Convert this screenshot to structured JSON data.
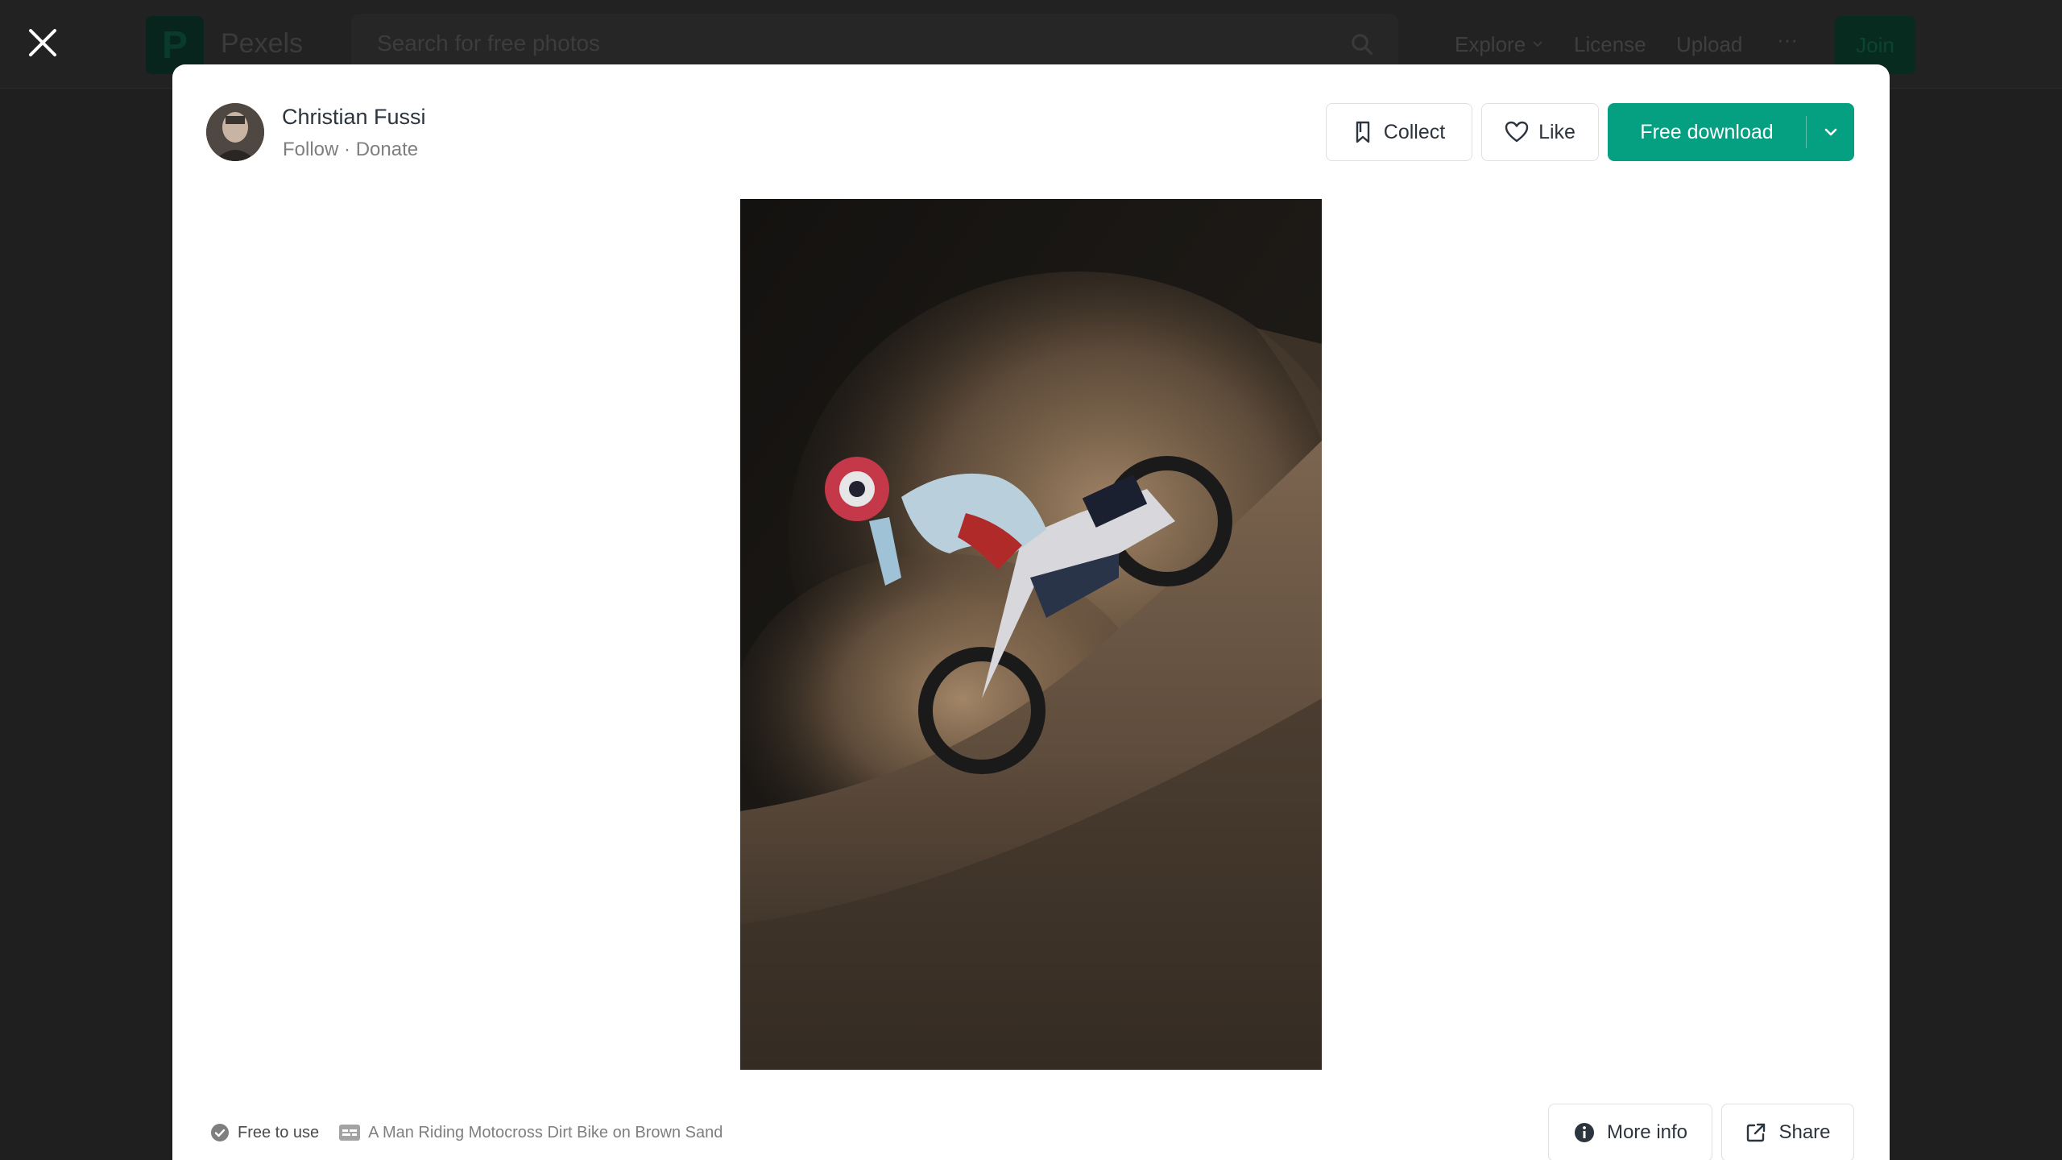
{
  "background_header": {
    "brand": "Pexels",
    "logo_letter": "P",
    "search_placeholder": "Search for free photos",
    "nav": {
      "explore": "Explore",
      "license": "License",
      "upload": "Upload",
      "more": "···",
      "join": "Join"
    }
  },
  "modal": {
    "author": {
      "name": "Christian Fussi",
      "follow": "Follow",
      "separator": "·",
      "donate": "Donate"
    },
    "actions": {
      "collect": "Collect",
      "like": "Like",
      "download": "Free download"
    },
    "photo": {
      "alt": "A Man Riding Motocross Dirt Bike on Brown Sand"
    },
    "footer": {
      "license": "Free to use",
      "description": "A Man Riding Motocross Dirt Bike on Brown Sand",
      "more_info": "More info",
      "share": "Share"
    }
  },
  "colors": {
    "accent": "#05a081",
    "overlay": "#1f1f1f"
  }
}
